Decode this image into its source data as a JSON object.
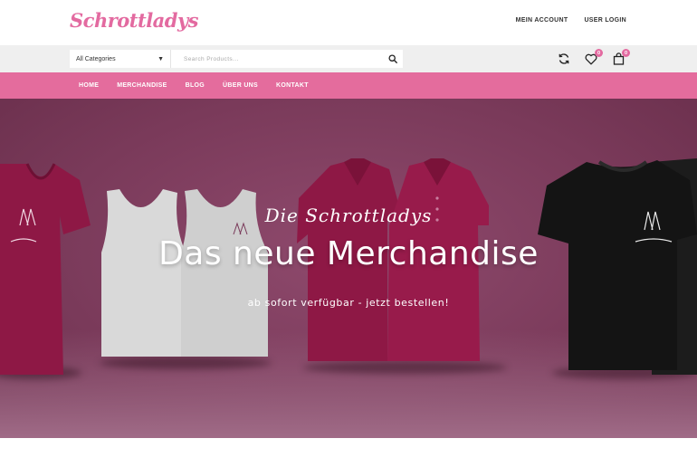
{
  "header": {
    "logo_text": "Schrottladys",
    "account_label": "MEIN ACCOUNT",
    "login_label": "USER LOGIN"
  },
  "search": {
    "category_label": "All Categories",
    "placeholder": "Search Products..."
  },
  "header_icons": {
    "compare_icon": "refresh-icon",
    "wishlist_icon": "heart-icon",
    "wishlist_count": "0",
    "cart_icon": "shopping-bag-icon",
    "cart_count": "0"
  },
  "nav": {
    "items": [
      "HOME",
      "MERCHANDISE",
      "BLOG",
      "ÜBER UNS",
      "KONTAKT"
    ]
  },
  "hero": {
    "script_text": "Die Schrottladys",
    "title": "Das neue Merchandise",
    "subtitle": "ab sofort verfügbar - jetzt bestellen!"
  },
  "colors": {
    "brand_pink": "#e46c9d",
    "hero_bg": "#7a3a5a",
    "garment_red": "#8e1845",
    "garment_grey": "#d8d8d8",
    "garment_black": "#141414"
  }
}
